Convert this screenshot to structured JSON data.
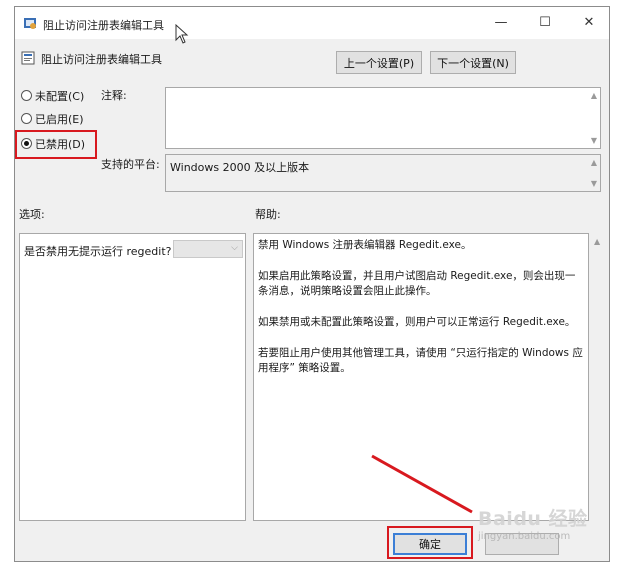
{
  "window": {
    "title": "阻止访问注册表编辑工具",
    "controls": {
      "minimize": "—",
      "maximize": "☐",
      "close": "✕"
    }
  },
  "policy": {
    "name": "阻止访问注册表编辑工具"
  },
  "nav": {
    "prev_label": "上一个设置(P)",
    "next_label": "下一个设置(N)"
  },
  "state": {
    "options": [
      {
        "label": "未配置(C)",
        "checked": false
      },
      {
        "label": "已启用(E)",
        "checked": false
      },
      {
        "label": "已禁用(D)",
        "checked": true
      }
    ]
  },
  "comment": {
    "label": "注释:",
    "value": ""
  },
  "platform": {
    "label": "支持的平台:",
    "value": "Windows 2000 及以上版本"
  },
  "options_section": {
    "label": "选项:",
    "item_label": "是否禁用无提示运行 regedit?"
  },
  "help": {
    "label": "帮助:",
    "paragraphs": [
      "禁用 Windows 注册表编辑器 Regedit.exe。",
      "如果启用此策略设置，并且用户试图启动 Regedit.exe，则会出现一条消息，说明策略设置会阻止此操作。",
      "如果禁用或未配置此策略设置，则用户可以正常运行 Regedit.exe。",
      "若要阻止用户使用其他管理工具，请使用 “只运行指定的 Windows 应用程序” 策略设置。"
    ]
  },
  "footer": {
    "ok_label": "确定"
  },
  "watermark": {
    "brand": "Baidu 经验",
    "url": "jingyan.baidu.com"
  },
  "colors": {
    "annotation_red": "#d8191f",
    "window_bg": "#f0f0f0"
  }
}
